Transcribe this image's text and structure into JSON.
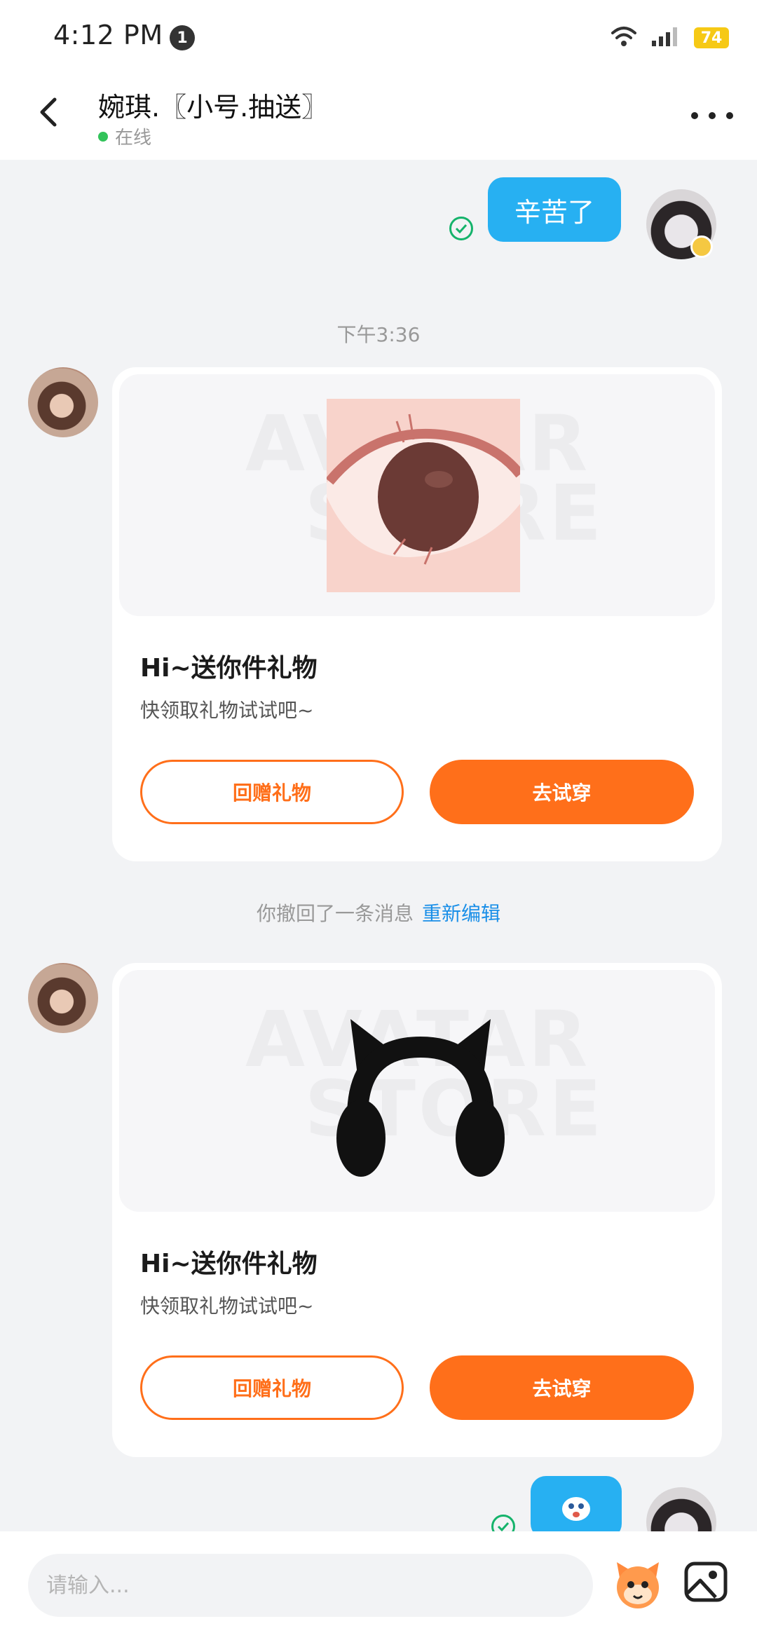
{
  "status_bar": {
    "time": "4:12 PM",
    "notification_count": "1",
    "battery": "74"
  },
  "header": {
    "title": "婉琪.〖小号.抽送〗",
    "status": "在线"
  },
  "messages": {
    "first_outgoing": "辛苦了",
    "timestamp": "下午3:36",
    "gift_1": {
      "title": "Hi~送你件礼物",
      "subtitle": "快领取礼物试试吧~",
      "return_gift_label": "回赠礼物",
      "try_on_label": "去试穿"
    },
    "recall_notice": "你撤回了一条消息",
    "recall_edit_link": "重新编辑",
    "gift_2": {
      "title": "Hi~送你件礼物",
      "subtitle": "快领取礼物试试吧~",
      "return_gift_label": "回赠礼物",
      "try_on_label": "去试穿"
    }
  },
  "composer": {
    "placeholder": "请输入..."
  },
  "colors": {
    "accent_blue": "#27b0f2",
    "accent_orange": "#ff6f1a",
    "link_blue": "#1a8fe8",
    "online_green": "#32c35a",
    "check_green": "#15b36b"
  },
  "icons": [
    "back-arrow-icon",
    "more-icon",
    "wifi-icon",
    "signal-icon",
    "check-icon",
    "emoji-icon",
    "image-icon"
  ]
}
